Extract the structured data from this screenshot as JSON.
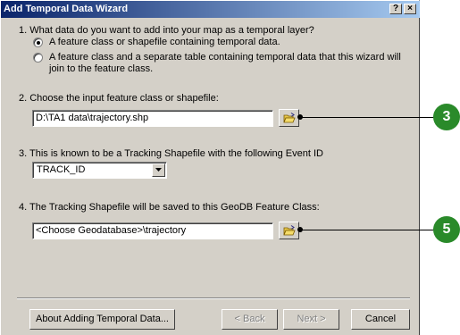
{
  "window": {
    "title": "Add Temporal Data Wizard",
    "help_label": "?",
    "close_label": "×"
  },
  "q1": {
    "text": "1.  What data do you want to add into your map as a temporal layer?",
    "option1": "A feature class or shapefile containing temporal data.",
    "option2_line1": "A feature class and a separate table containing temporal data that this wizard will",
    "option2_line2": "join to the feature class.",
    "selected": 1
  },
  "q2": {
    "text": "2.  Choose the input feature class or shapefile:",
    "value": "D:\\TA1 data\\trajectory.shp"
  },
  "q3": {
    "text": "3.  This is known to be a Tracking Shapefile with the following Event ID",
    "selected_value": "TRACK_ID"
  },
  "q4": {
    "text": "4.  The Tracking Shapefile will be saved to this GeoDB Feature Class:",
    "value": "<Choose Geodatabase>\\trajectory"
  },
  "buttons": {
    "about": "About Adding Temporal Data...",
    "back": "< Back",
    "next": "Next >",
    "cancel": "Cancel"
  },
  "callouts": {
    "first": "3",
    "second": "5"
  },
  "colors": {
    "title_gradient_start": "#0a246a",
    "title_gradient_end": "#a6caf0",
    "dialog_face": "#d4d0c8",
    "callout": "#2a8a2a"
  }
}
